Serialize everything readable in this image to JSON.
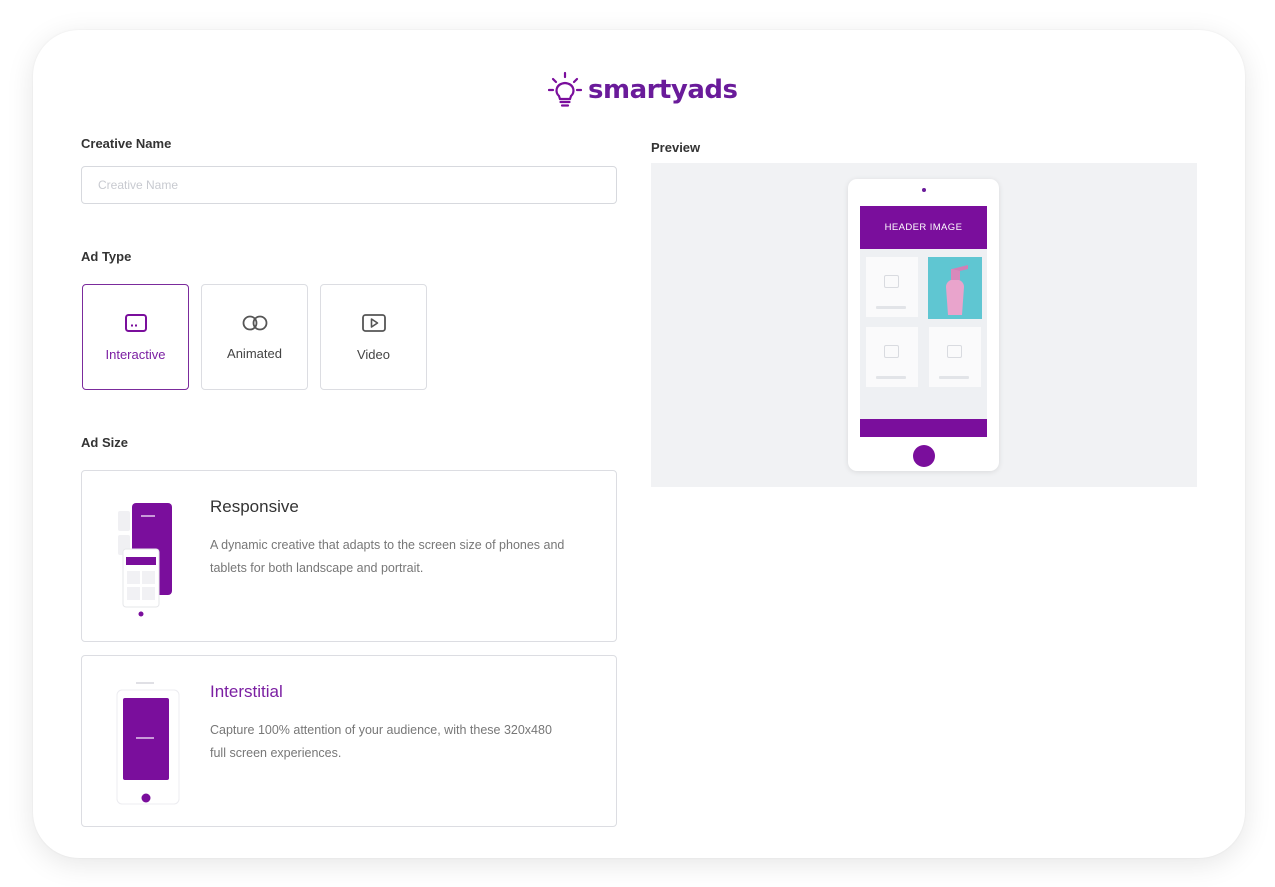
{
  "brand": {
    "name_light": "smarty",
    "name_bold": "ads",
    "accent": "#7a0e9c"
  },
  "form": {
    "creative_name_label": "Creative Name",
    "creative_name_placeholder": "Creative Name",
    "creative_name_value": "",
    "ad_type_label": "Ad Type",
    "ad_types": [
      {
        "label": "Interactive",
        "icon": "interactive-icon",
        "selected": true
      },
      {
        "label": "Animated",
        "icon": "animated-icon",
        "selected": false
      },
      {
        "label": "Video",
        "icon": "video-icon",
        "selected": false
      }
    ],
    "ad_size_label": "Ad Size",
    "ad_sizes": [
      {
        "title": "Responsive",
        "description": "A dynamic creative that adapts to the screen size of phones and tablets for both landscape and portrait.",
        "highlighted": false
      },
      {
        "title": "Interstitial",
        "description": "Capture 100% attention of your audience, with these 320x480 full screen experiences.",
        "highlighted": true
      }
    ]
  },
  "preview": {
    "label": "Preview",
    "header_text": "HEADER IMAGE"
  }
}
